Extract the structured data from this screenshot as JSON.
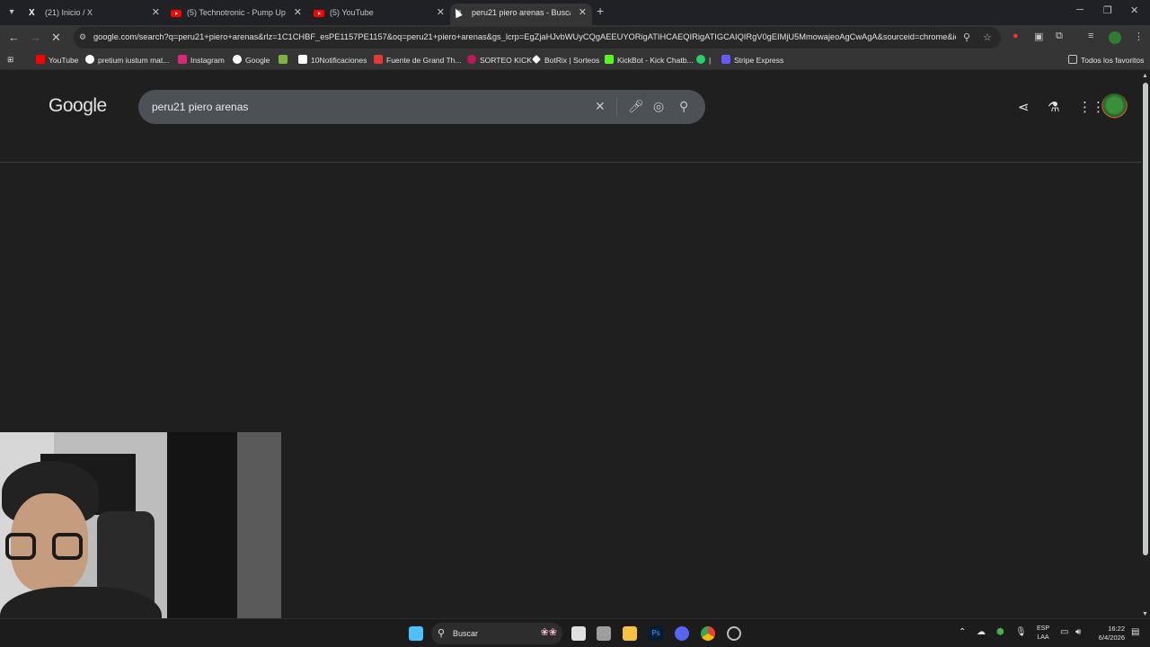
{
  "colors": {
    "page_bg": "#1f1f1f",
    "toolbar_bg": "#353535",
    "tabbar_bg": "#202124",
    "searchbox_bg": "#4d5156"
  },
  "tabs": [
    {
      "title": "(21) Inicio / X",
      "icon": "x-logo-icon"
    },
    {
      "title": "(5) Technotronic - Pump Up The",
      "icon": "youtube-icon"
    },
    {
      "title": "(5) YouTube",
      "icon": "youtube-icon"
    },
    {
      "title": "peru21 piero arenas - Buscar co",
      "icon": "audio-playing-icon",
      "active": true
    }
  ],
  "address_bar": {
    "url": "google.com/search?q=peru21+piero+arenas&rlz=1C1CHBF_esPE1157PE1157&oq=peru21+piero+arenas&gs_lcrp=EgZjaHJvbWUyCQgAEEUYORigATIHCAEQIRigATIGCAIQIRgV0gEIMjU5MmowajeoAgCwAgA&sourceid=chrome&ie=..."
  },
  "bookmarks": [
    {
      "label": "YouTube",
      "icon": "youtube-icon",
      "color": "#ff0000"
    },
    {
      "label": "pretium iustum mat...",
      "icon": "google-icon",
      "color": "#ffffff"
    },
    {
      "label": "Instagram",
      "icon": "instagram-icon",
      "color": "#d62976"
    },
    {
      "label": "Google",
      "icon": "google-icon",
      "color": "#ffffff"
    },
    {
      "label": "",
      "icon": "pinwheel-icon",
      "color": "#7cb342"
    },
    {
      "label": "10Notificaciones",
      "icon": "x-logo-icon",
      "color": "#ffffff"
    },
    {
      "label": "Fuente de Grand Th...",
      "icon": "font-icon",
      "color": "#e53935"
    },
    {
      "label": "SORTEO KICK",
      "icon": "flower-icon",
      "color": "#c2185b"
    },
    {
      "label": "BotRix | Sorteos",
      "icon": "diamond-icon",
      "color": "#ffffff"
    },
    {
      "label": "KickBot - Kick Chatb...",
      "icon": "kickbot-icon",
      "color": "#53fc18"
    },
    {
      "label": "|",
      "icon": "whatsapp-icon",
      "color": "#25d366"
    },
    {
      "label": "Stripe Express",
      "icon": "stripe-icon",
      "color": "#635bff"
    }
  ],
  "all_bookmarks_label": "Todos los favoritos",
  "google": {
    "logo": "Google",
    "query": "peru21 piero arenas"
  },
  "taskbar": {
    "search_label": "Buscar",
    "lang_line1": "ESP",
    "lang_line2": "LAA",
    "time": "16:22",
    "date": "6/4/2026"
  }
}
